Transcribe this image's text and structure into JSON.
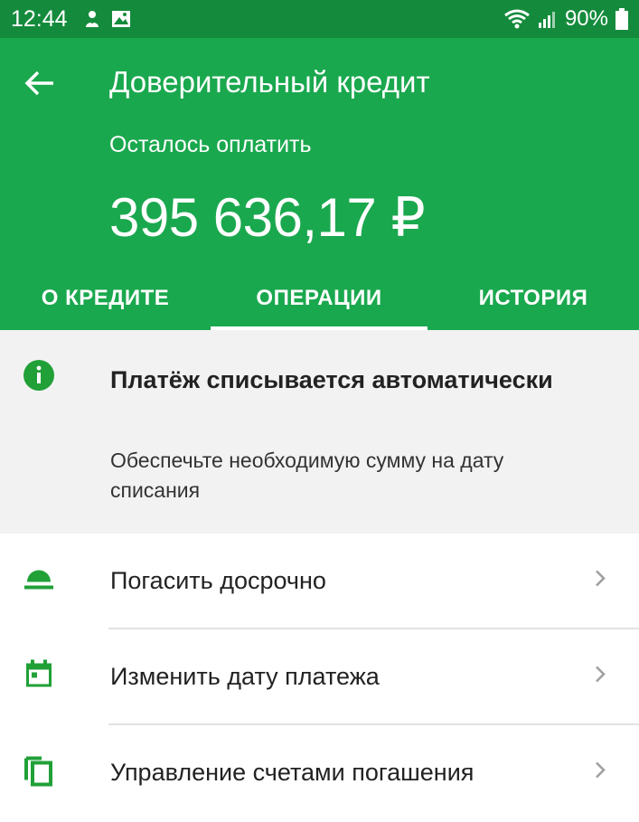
{
  "status_bar": {
    "time": "12:44",
    "battery": "90%",
    "icons": [
      "person-icon",
      "image-icon",
      "wifi-icon",
      "signal-icon",
      "battery-icon"
    ]
  },
  "header": {
    "back_icon": "arrow-left-icon",
    "title": "Доверительный кредит",
    "subtitle": "Осталось оплатить",
    "amount": "395 636,17 ₽",
    "background_color": "#1aa84e"
  },
  "tabs": [
    {
      "label": "О КРЕДИТЕ",
      "active": false
    },
    {
      "label": "ОПЕРАЦИИ",
      "active": true
    },
    {
      "label": "ИСТОРИЯ",
      "active": false
    }
  ],
  "notice": {
    "icon": "info-icon",
    "title": "Платёж списывается автоматически",
    "text": "Обеспечьте необходимую сумму на дату списания"
  },
  "menu": {
    "items": [
      {
        "icon": "dome-icon",
        "label": "Погасить досрочно"
      },
      {
        "icon": "calendar-icon",
        "label": "Изменить дату платежа"
      },
      {
        "icon": "copy-icon",
        "label": "Управление счетами погашения"
      }
    ]
  },
  "colors": {
    "accent": "#1aa84e",
    "status_bar": "#148b3c",
    "icon_green": "#21a038"
  }
}
